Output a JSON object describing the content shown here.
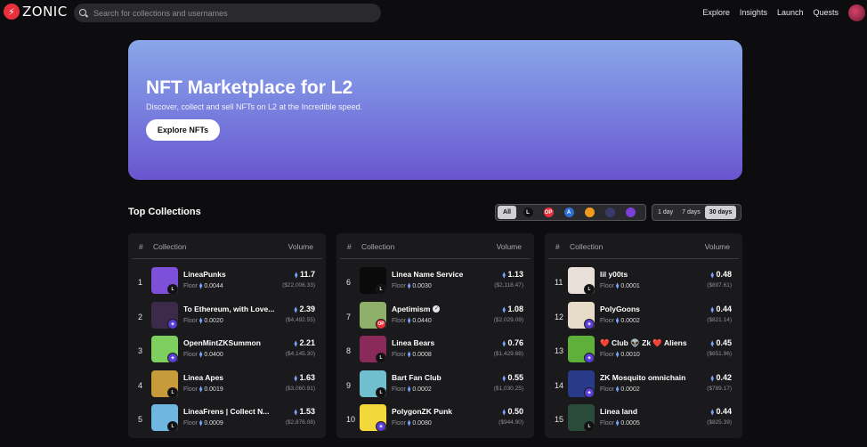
{
  "brand": {
    "name": "ZONIC"
  },
  "search": {
    "placeholder": "Search for collections and usernames"
  },
  "nav": [
    "Explore",
    "Insights",
    "Launch",
    "Quests"
  ],
  "hero": {
    "title": "NFT Marketplace for L2",
    "subtitle": "Discover, collect and sell NFTs on L2 at the Incredible speed.",
    "cta": "Explore NFTs"
  },
  "section": {
    "title": "Top Collections"
  },
  "chain_filter": {
    "all_label": "All",
    "chains": [
      {
        "icon": "linea-icon",
        "glyph": "L",
        "color": "#111111"
      },
      {
        "icon": "optimism-icon",
        "glyph": "OP",
        "color": "#e8313b"
      },
      {
        "icon": "arbitrum-icon",
        "glyph": "A",
        "color": "#2d6fd2"
      },
      {
        "icon": "base-icon",
        "glyph": "",
        "color": "#f19a1f"
      },
      {
        "icon": "zksync-icon",
        "glyph": "",
        "color": "#3a3a6a"
      },
      {
        "icon": "polygon-zkevm-icon",
        "glyph": "",
        "color": "#7a3fd6"
      }
    ]
  },
  "time_filter": [
    "1 day",
    "7 days",
    "30 days"
  ],
  "table_head": {
    "num": "#",
    "collection": "Collection",
    "volume": "Volume"
  },
  "floor_label": "Floor",
  "eth_symbol": "⧫",
  "collections": [
    {
      "rank": "1",
      "name": "LineaPunks",
      "floor": "0.0044",
      "volume": "11.7",
      "usd": "($22,006.33)",
      "chain": "linea",
      "color": "#7e4fd8"
    },
    {
      "rank": "2",
      "name": "To Ethereum, with Love...",
      "floor": "0.0020",
      "volume": "2.39",
      "usd": "($4,492.55)",
      "chain": "zk",
      "color": "#3b2a4a"
    },
    {
      "rank": "3",
      "name": "OpenMintZKSummon",
      "floor": "0.0400",
      "volume": "2.21",
      "usd": "($4,145.30)",
      "chain": "zk",
      "color": "#7fcf5f"
    },
    {
      "rank": "4",
      "name": "Linea Apes",
      "floor": "0.0019",
      "volume": "1.63",
      "usd": "($3,060.91)",
      "chain": "linea",
      "color": "#c79a3a"
    },
    {
      "rank": "5",
      "name": "LineaFrens | Collect N...",
      "floor": "0.0009",
      "volume": "1.53",
      "usd": "($2,876.08)",
      "chain": "linea",
      "color": "#6fb7e0"
    },
    {
      "rank": "6",
      "name": "Linea Name Service",
      "floor": "0.0030",
      "volume": "1.13",
      "usd": "($2,118.47)",
      "chain": "linea",
      "color": "#0a0a0a"
    },
    {
      "rank": "7",
      "name": "Apetimism",
      "floor": "0.0440",
      "volume": "1.08",
      "usd": "($2,029.09)",
      "chain": "op",
      "color": "#8fb06a",
      "verified": "✓"
    },
    {
      "rank": "8",
      "name": "Linea Bears",
      "floor": "0.0008",
      "volume": "0.76",
      "usd": "($1,429.88)",
      "chain": "linea",
      "color": "#8a2a5a"
    },
    {
      "rank": "9",
      "name": "Bart Fan Club",
      "floor": "0.0002",
      "volume": "0.55",
      "usd": "($1,030.25)",
      "chain": "linea",
      "color": "#6fbfcf"
    },
    {
      "rank": "10",
      "name": "PolygonZK Punk",
      "floor": "0.0080",
      "volume": "0.50",
      "usd": "($944.90)",
      "chain": "zk",
      "color": "#f2d83a"
    },
    {
      "rank": "11",
      "name": "lil y00ts",
      "floor": "0.0001",
      "volume": "0.48",
      "usd": "($897.61)",
      "chain": "linea",
      "color": "#e8e0d8"
    },
    {
      "rank": "12",
      "name": "PolyGoons",
      "floor": "0.0002",
      "volume": "0.44",
      "usd": "($821.14)",
      "chain": "zk",
      "color": "#e6dcc8"
    },
    {
      "rank": "13",
      "name": "❤️ Club 👽 Zk ❤️ Aliens",
      "floor": "0.0010",
      "volume": "0.45",
      "usd": "($851.96)",
      "chain": "zk",
      "color": "#5fb03a"
    },
    {
      "rank": "14",
      "name": "ZK Mosquito omnichain",
      "floor": "0.0002",
      "volume": "0.42",
      "usd": "($789.17)",
      "chain": "zk",
      "color": "#2a3a8a"
    },
    {
      "rank": "15",
      "name": "Linea land",
      "floor": "0.0005",
      "volume": "0.44",
      "usd": "($825.39)",
      "chain": "linea",
      "color": "#2a4a3a"
    }
  ]
}
